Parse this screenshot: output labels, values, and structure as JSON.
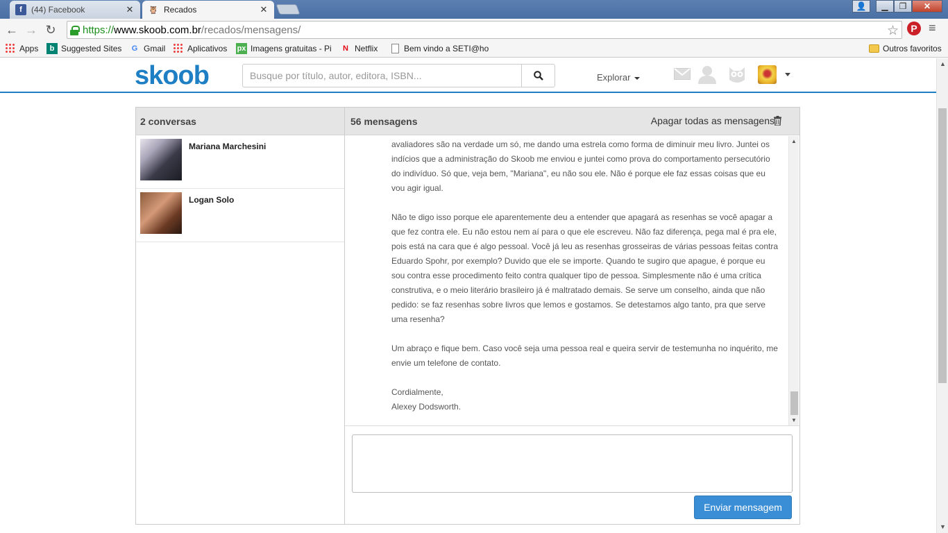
{
  "browser": {
    "tabs": [
      {
        "title": "(44) Facebook",
        "favicon": "facebook-icon"
      },
      {
        "title": "Recados",
        "favicon": "skoob-icon"
      }
    ],
    "address": {
      "scheme": "https://",
      "host": "www.skoob.com.br",
      "path": "/recados/mensagens/"
    },
    "bookmarks": [
      {
        "label": "Apps",
        "icon": "apps-grid-icon"
      },
      {
        "label": "Suggested Sites",
        "icon": "bing-icon"
      },
      {
        "label": "Gmail",
        "icon": "google-icon"
      },
      {
        "label": "Aplicativos",
        "icon": "apps-grid-icon"
      },
      {
        "label": "Imagens gratuitas - Pi",
        "icon": "pixabay-icon"
      },
      {
        "label": "Netflix",
        "icon": "netflix-icon"
      },
      {
        "label": "Bem vindo a SETI@ho",
        "icon": "page-icon"
      },
      {
        "label": "Outros favoritos",
        "icon": "folder-icon"
      }
    ]
  },
  "site": {
    "logo": "skoob",
    "search_placeholder": "Busque por título, autor, editora, ISBN...",
    "explore_label": "Explorar",
    "brand_color": "#1e7fc4"
  },
  "conversations": {
    "header": "2 conversas",
    "items": [
      {
        "name": "Mariana Marchesini"
      },
      {
        "name": "Logan Solo"
      }
    ]
  },
  "messages": {
    "header": "56 mensagens",
    "delete_all_label": "Apagar todas as mensagens",
    "paragraphs": [
      "avaliadores são na verdade um só, me dando uma estrela como forma de diminuir meu livro. Juntei os indícios que a administração do Skoob me enviou e juntei como prova do comportamento persecutório do indivíduo. Só que, veja bem, \"Mariana\", eu não sou ele. Não é porque ele faz essas coisas que eu vou agir igual.",
      "Não te digo isso porque ele aparentemente deu a entender que apagará as resenhas se você apagar a que fez contra ele. Eu não estou nem aí para o que ele escreveu. Não faz diferença, pega mal é pra ele, pois está na cara que é algo pessoal. Você já leu as resenhas grosseiras de várias pessoas feitas contra Eduardo Spohr, por exemplo? Duvido que ele se importe. Quando te sugiro que apague, é porque eu sou contra esse procedimento feito contra qualquer tipo de pessoa. Simplesmente não é uma crítica construtiva, e o meio literário brasileiro já é maltratado demais. Se serve um conselho, ainda que não pedido: se faz resenhas sobre livros que lemos e gostamos. Se detestamos algo tanto, pra que serve uma resenha?",
      "Um abraço e fique bem. Caso você seja uma pessoa real e queira servir de testemunha no inquérito, me envie um telefone de contato."
    ],
    "closing": "Cordialmente,",
    "signature": "Alexey Dodsworth.",
    "reply_value": "",
    "send_label": "Enviar mensagem"
  }
}
